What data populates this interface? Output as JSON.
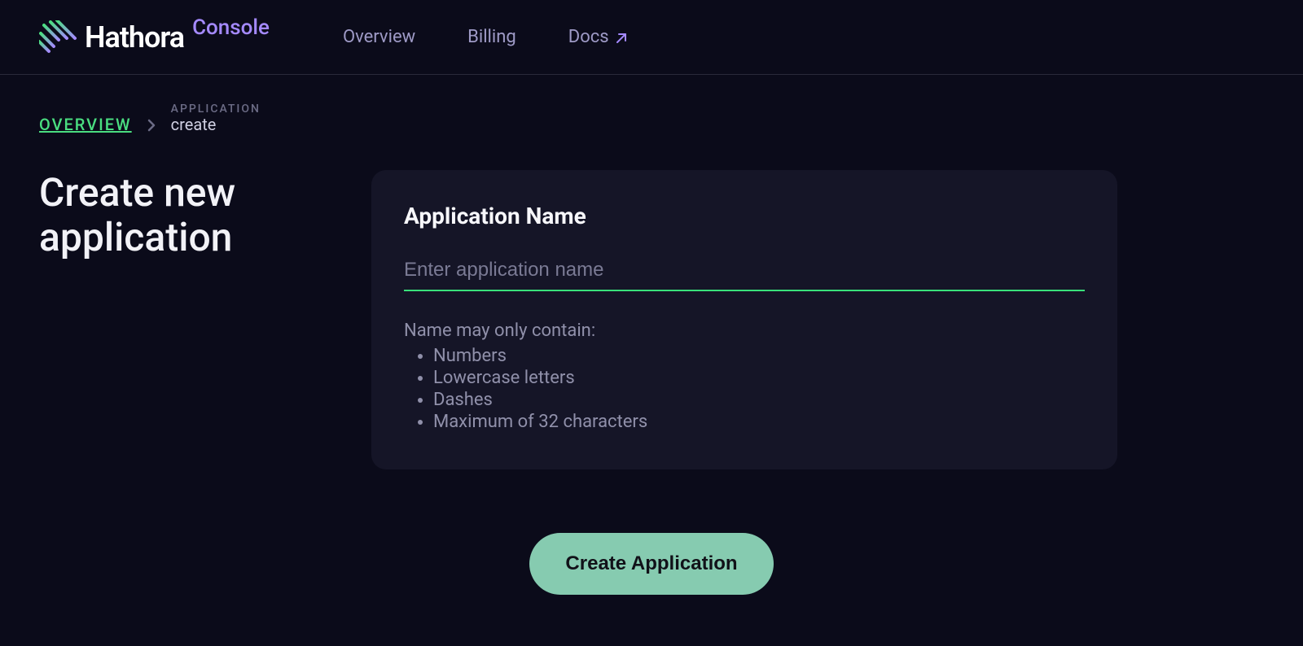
{
  "brand": {
    "name": "Hathora",
    "suffix": "Console"
  },
  "nav": {
    "overview": "Overview",
    "billing": "Billing",
    "docs": "Docs"
  },
  "breadcrumb": {
    "root": "OVERVIEW",
    "eyebrow": "APPLICATION",
    "current": "create"
  },
  "page": {
    "title": "Create new application"
  },
  "form": {
    "label": "Application Name",
    "placeholder": "Enter application name",
    "value": "",
    "helper_intro": "Name may only contain:",
    "rules": [
      "Numbers",
      "Lowercase letters",
      "Dashes",
      "Maximum of 32 characters"
    ]
  },
  "cta": {
    "submit": "Create Application"
  },
  "colors": {
    "accent_green": "#39e07a",
    "purple": "#a58aff",
    "button_green": "#86cbb0"
  }
}
